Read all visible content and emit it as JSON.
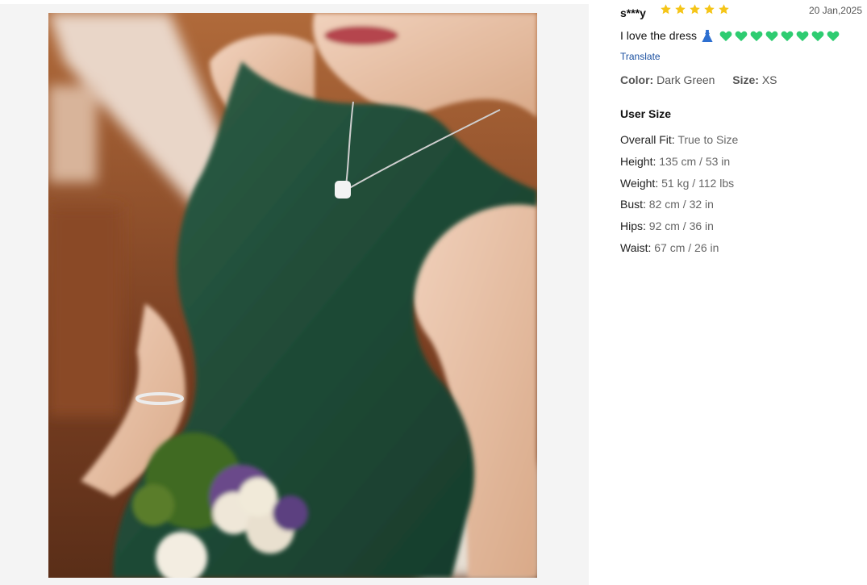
{
  "review": {
    "username": "s***y",
    "rating": 5,
    "date": "20 Jan,2025",
    "text": "I love the dress",
    "translate_label": "Translate",
    "color_label": "Color:",
    "color_value": "Dark Green",
    "size_label": "Size:",
    "size_value": "XS"
  },
  "user_size": {
    "title": "User Size",
    "rows": [
      {
        "label": "Overall Fit:",
        "value": "True to Size"
      },
      {
        "label": "Height:",
        "value": "135 cm / 53 in"
      },
      {
        "label": "Weight:",
        "value": "51 kg / 112 lbs"
      },
      {
        "label": "Bust:",
        "value": "82 cm / 32 in"
      },
      {
        "label": "Hips:",
        "value": "92 cm / 36 in"
      },
      {
        "label": "Waist:",
        "value": "67 cm / 26 in"
      }
    ]
  },
  "icons": {
    "star": "star-icon",
    "dress": "dress-emoji-icon",
    "heart": "green-heart-emoji-icon"
  },
  "colors": {
    "star": "#f5c518",
    "heart": "#2ecc71",
    "link": "#1a4fa0",
    "dress_green": "#1f4a36"
  }
}
